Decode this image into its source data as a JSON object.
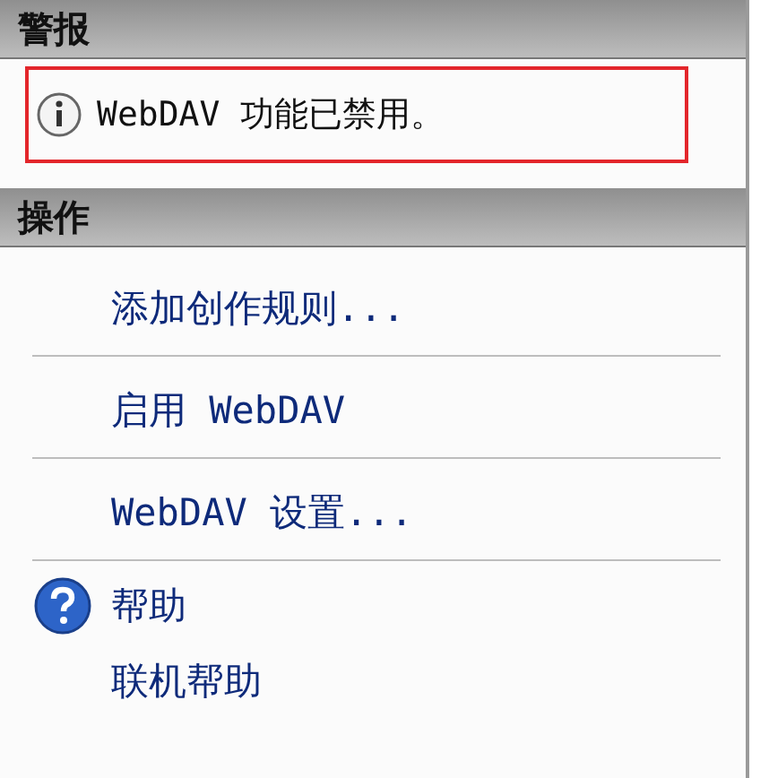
{
  "sections": [
    {
      "title": "警报",
      "alerts": [
        {
          "text": "WebDAV 功能已禁用。",
          "highlighted": true
        }
      ]
    },
    {
      "title": "操作",
      "action_groups": [
        [
          {
            "label": "添加创作规则...",
            "kind": "plain"
          }
        ],
        [
          {
            "label": "启用 WebDAV",
            "kind": "plain"
          }
        ],
        [
          {
            "label": "WebDAV 设置...",
            "kind": "plain"
          }
        ],
        [
          {
            "label": "帮助",
            "kind": "help"
          },
          {
            "label": "联机帮助",
            "kind": "plain"
          }
        ]
      ]
    }
  ]
}
